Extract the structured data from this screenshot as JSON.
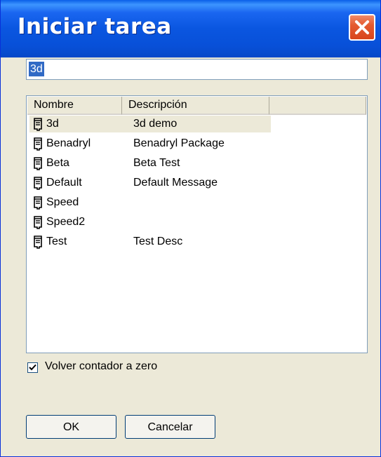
{
  "window": {
    "title": "Iniciar tarea",
    "close_icon": "close-icon"
  },
  "task_input": {
    "value": "3d"
  },
  "list": {
    "columns": [
      "Nombre",
      "Descripción",
      ""
    ],
    "row_icon": "task-icon",
    "selected_index": 0,
    "rows": [
      {
        "name": "3d",
        "description": "3d demo"
      },
      {
        "name": "Benadryl",
        "description": "Benadryl Package"
      },
      {
        "name": "Beta",
        "description": "Beta Test"
      },
      {
        "name": "Default",
        "description": "Default Message"
      },
      {
        "name": "Speed",
        "description": ""
      },
      {
        "name": "Speed2",
        "description": ""
      },
      {
        "name": "Test",
        "description": "Test Desc"
      }
    ]
  },
  "reset_counter": {
    "label": "Volver contador a zero",
    "checked": true
  },
  "buttons": {
    "ok_label": "OK",
    "cancel_label": "Cancelar"
  },
  "colors": {
    "titlebar": "#0a56e0",
    "close_button": "#e45a30",
    "selection": "#316ac5",
    "dialog_background": "#ece9d8"
  }
}
